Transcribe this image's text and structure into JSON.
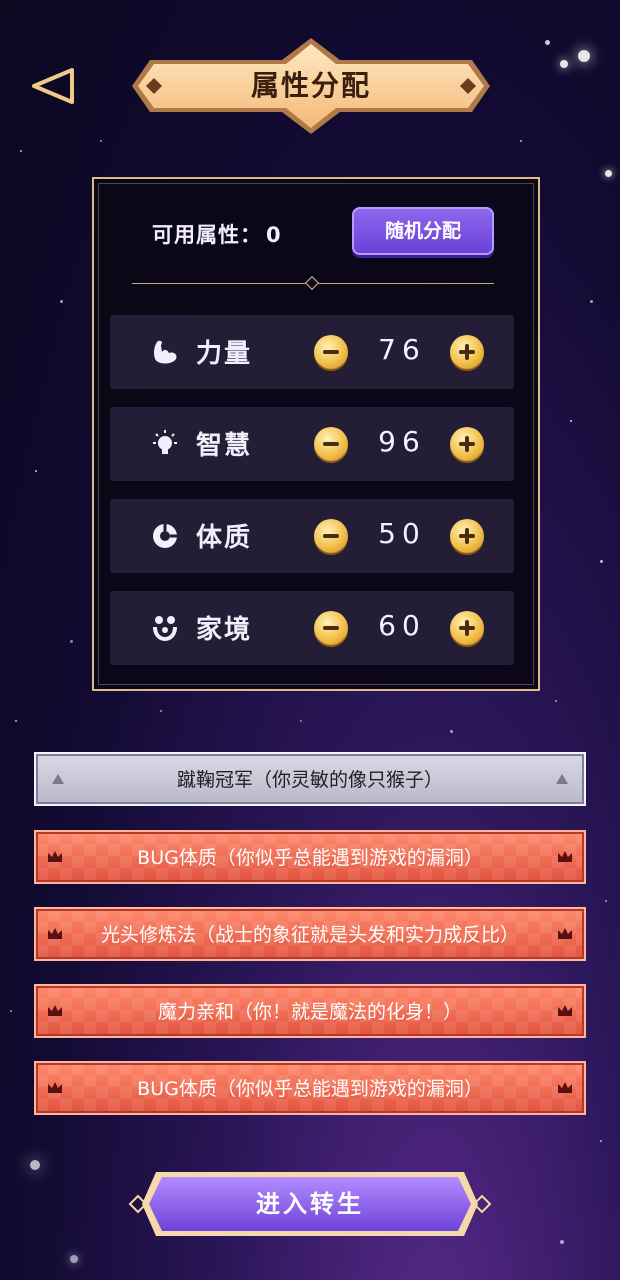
{
  "header": {
    "title": "属性分配",
    "back_icon": "back-arrow-icon"
  },
  "panel": {
    "available_label": "可用属性：",
    "available_value": "0",
    "random_button_label": "随机分配"
  },
  "attributes": [
    {
      "name": "力量",
      "value": "76",
      "icon": "muscle-icon"
    },
    {
      "name": "智慧",
      "value": "96",
      "icon": "lightbulb-icon"
    },
    {
      "name": "体质",
      "value": "50",
      "icon": "constitution-icon"
    },
    {
      "name": "家境",
      "value": "60",
      "icon": "family-icon"
    }
  ],
  "talents": [
    {
      "label": "蹴鞠冠军（你灵敏的像只猴子）",
      "style": "silver"
    },
    {
      "label": "BUG体质（你似乎总能遇到游戏的漏洞）",
      "style": "red"
    },
    {
      "label": "光头修炼法（战士的象征就是头发和实力成反比）",
      "style": "red"
    },
    {
      "label": "魔力亲和（你！就是魔法的化身！）",
      "style": "red"
    },
    {
      "label": "BUG体质（你似乎总能遇到游戏的漏洞）",
      "style": "red"
    }
  ],
  "footer": {
    "enter_button_label": "进入转生"
  },
  "colors": {
    "accent_gold": "#e0b98a",
    "button_purple": "#7a52e0",
    "talent_red": "#ef6a52",
    "talent_silver": "#c8c8d6"
  }
}
